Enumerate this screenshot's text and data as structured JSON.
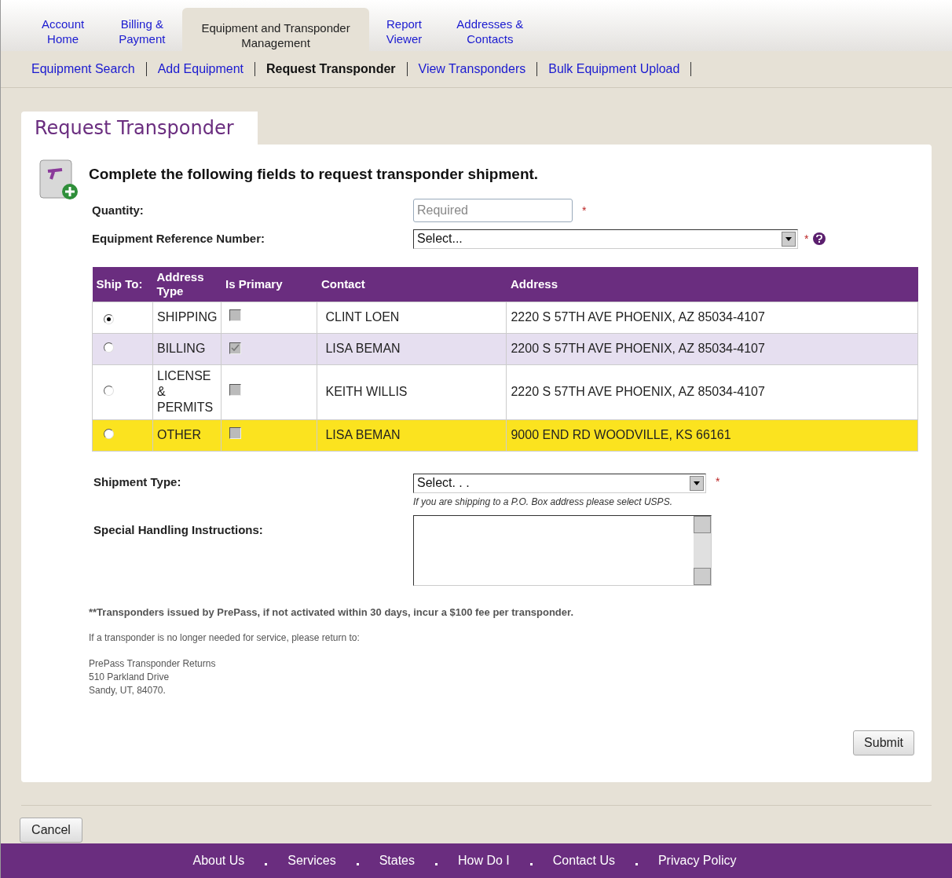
{
  "top_tabs": [
    {
      "label": "Account\nHome",
      "selected": false
    },
    {
      "label": "Billing &\nPayment",
      "selected": false
    },
    {
      "label": "Equipment and Transponder\nManagement",
      "selected": true
    },
    {
      "label": "Report\nViewer",
      "selected": false
    },
    {
      "label": "Addresses &\nContacts",
      "selected": false
    }
  ],
  "sub_nav": [
    {
      "label": "Equipment Search",
      "selected": false
    },
    {
      "label": "Add Equipment",
      "selected": false
    },
    {
      "label": "Request Transponder",
      "selected": true
    },
    {
      "label": "View Transponders",
      "selected": false
    },
    {
      "label": "Bulk Equipment Upload",
      "selected": false
    }
  ],
  "page_title": "Request Transponder",
  "intro": "Complete the following fields to request transponder shipment.",
  "quantity": {
    "label": "Quantity:",
    "placeholder": "Required",
    "required_mark": "*"
  },
  "equipment_reference": {
    "label": "Equipment Reference Number:",
    "value": "Select...",
    "required_mark": "*"
  },
  "ship_table": {
    "columns": [
      "Ship To:",
      "Address\nType",
      "Is Primary",
      "Contact",
      "Address"
    ],
    "rows": [
      {
        "selected": true,
        "address_type": "SHIPPING",
        "primary": false,
        "highlighted": false,
        "contact": "CLINT LOEN",
        "address": "2220 S 57TH AVE PHOENIX, AZ 85034-4107"
      },
      {
        "selected": false,
        "address_type": "BILLING",
        "primary": true,
        "highlighted": false,
        "contact": "LISA BEMAN",
        "address": "2200 S 57TH AVE PHOENIX, AZ 85034-4107"
      },
      {
        "selected": false,
        "address_type": "LICENSE\n&\nPERMITS",
        "primary": false,
        "highlighted": false,
        "contact": "KEITH WILLIS",
        "address": "2220 S 57TH AVE PHOENIX, AZ 85034-4107"
      },
      {
        "selected": false,
        "address_type": "OTHER",
        "primary": false,
        "highlighted": true,
        "contact": "LISA BEMAN",
        "address": "9000 END RD WOODVILLE, KS 66161"
      }
    ]
  },
  "shipment_type": {
    "label": "Shipment Type:",
    "value": "Select. . .",
    "required_mark": "*",
    "hint": "If you are shipping to a P.O. Box address please select USPS."
  },
  "special_handling": {
    "label": "Special Handling Instructions:"
  },
  "fee_note": "**Transponders issued by PrePass, if not activated within 30 days, incur a $100 fee per transponder.",
  "return_note": "If a transponder is no longer needed for service, please return to:",
  "return_address": [
    "PrePass Transponder Returns",
    "510 Parkland Drive",
    "Sandy, UT, 84070."
  ],
  "submit_button": "Submit",
  "cancel_button": "Cancel",
  "footer_links": [
    "About Us",
    "Services",
    "States",
    "How Do I",
    "Contact Us",
    "Privacy Policy"
  ]
}
